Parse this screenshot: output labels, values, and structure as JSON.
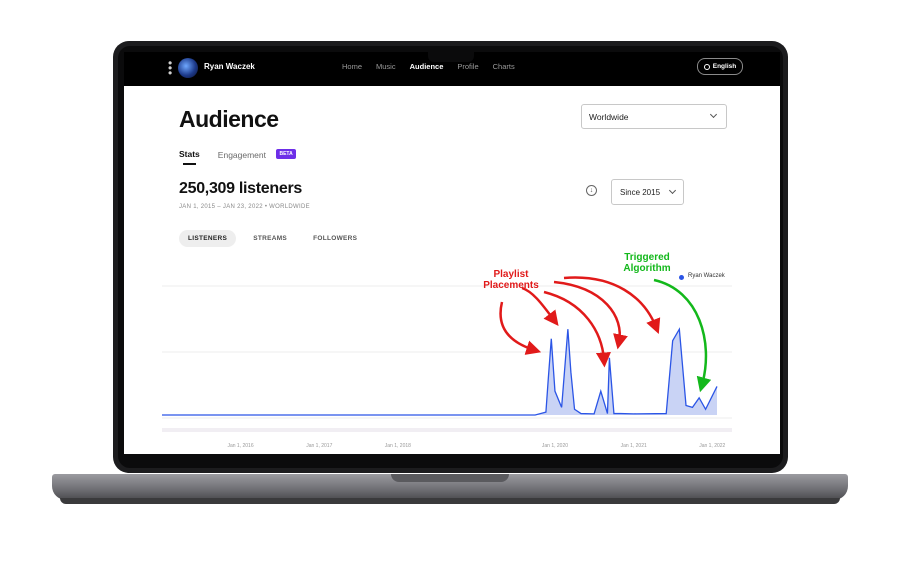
{
  "nav": {
    "artist_name": "Ryan Waczek",
    "links": [
      "Home",
      "Music",
      "Audience",
      "Profile",
      "Charts"
    ],
    "active_index": 2,
    "language_label": "English"
  },
  "page": {
    "title": "Audience",
    "region_select": "Worldwide",
    "tabs": [
      {
        "label": "Stats",
        "active": true
      },
      {
        "label": "Engagement",
        "active": false
      }
    ],
    "beta_badge": "BETA",
    "listeners_count": "250,309 listeners",
    "date_range": "JAN 1, 2015 – JAN 23, 2022 • WORLDWIDE",
    "since_select": "Since 2015",
    "metric_pills": [
      {
        "label": "LISTENERS",
        "active": true
      },
      {
        "label": "STREAMS",
        "active": false
      },
      {
        "label": "FOLLOWERS",
        "active": false
      }
    ]
  },
  "annotations": {
    "playlist_line1": "Playlist",
    "playlist_line2": "Placements",
    "algo_line1": "Triggered",
    "algo_line2": "Algorithm",
    "playlist_color": "#e11a1a",
    "algo_color": "#13b81b"
  },
  "colors": {
    "series": "#2b55e6",
    "series_fill": "#c9d3f5",
    "badge": "#6d2ee8"
  },
  "chart_data": {
    "type": "area",
    "series": [
      {
        "name": "Ryan Waczek",
        "x": [
          "2015-01-01",
          "2019-10-01",
          "2019-11-20",
          "2019-12-01",
          "2019-12-15",
          "2020-01-01",
          "2020-02-01",
          "2020-03-01",
          "2020-03-15",
          "2020-04-01",
          "2020-05-01",
          "2020-07-01",
          "2020-08-01",
          "2020-09-01",
          "2020-09-10",
          "2020-10-01",
          "2020-11-01",
          "2021-01-01",
          "2021-06-01",
          "2021-07-01",
          "2021-08-01",
          "2021-09-01",
          "2021-10-01",
          "2021-11-01",
          "2021-12-01",
          "2022-01-23"
        ],
        "values": [
          0,
          0,
          3000,
          38000,
          80000,
          25000,
          8000,
          90000,
          45000,
          6000,
          1500,
          1200,
          25000,
          1500,
          60000,
          1500,
          1500,
          1200,
          1500,
          78000,
          90000,
          10000,
          8000,
          18000,
          6000,
          30000
        ]
      }
    ],
    "x_ticks": [
      "Jan 1, 2016",
      "Jan 1, 2017",
      "Jan 1, 2018",
      "Jan 1, 2020",
      "Jan 1, 2021",
      "Jan 1, 2022"
    ],
    "ylim": [
      0,
      150000
    ],
    "grid": true,
    "legend": "top-right"
  }
}
